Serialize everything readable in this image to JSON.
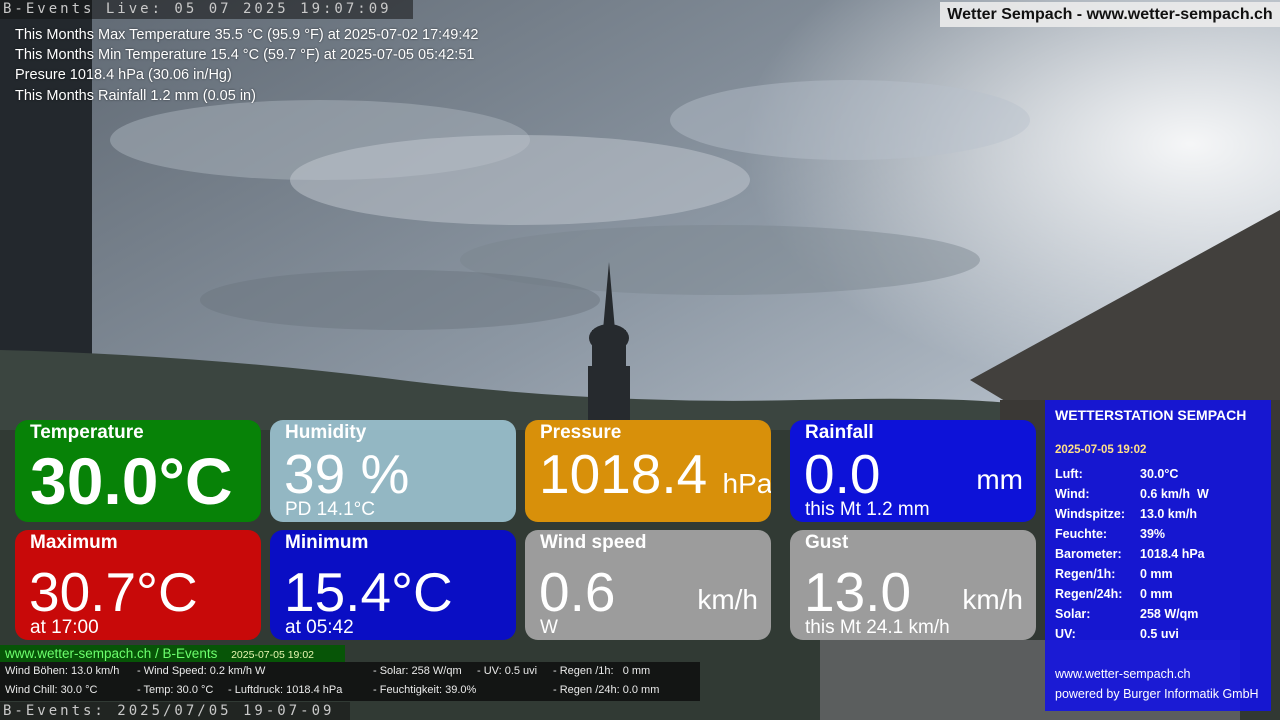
{
  "header": {
    "live_stamp": "B-Events Live: 05 07 2025 19:07:09",
    "site_title": "Wetter Sempach - www.wetter-sempach.ch"
  },
  "stats": [
    "This Months Max Temperature 35.5 °C (95.9 °F) at 2025-07-02 17:49:42",
    "This Months Min Temperature 15.4 °C (59.7 °F) at 2025-07-05 05:42:51",
    "Presure 1018.4 hPa (30.06 in/Hg)",
    "This Months Rainfall 1.2 mm (0.05 in)"
  ],
  "tiles": {
    "temperature": {
      "label": "Temperature",
      "value": "30.0°C",
      "color": "#078207"
    },
    "humidity": {
      "label": "Humidity",
      "value": "39 %",
      "sub": "PD 14.1°C"
    },
    "pressure": {
      "label": "Pressure",
      "value": "1018.4",
      "unit": "hPa",
      "color": "#d8900a"
    },
    "rainfall": {
      "label": "Rainfall",
      "value": "0.0",
      "unit": "mm",
      "sub": "this Mt 1.2 mm"
    },
    "maximum": {
      "label": "Maximum",
      "value": "30.7°C",
      "sub": "at 17:00",
      "color": "#c80909"
    },
    "minimum": {
      "label": "Minimum",
      "value": "15.4°C",
      "sub": "at 05:42"
    },
    "wind_speed": {
      "label": "Wind speed",
      "value": "0.6",
      "unit": "km/h",
      "sub": "W"
    },
    "gust": {
      "label": "Gust",
      "value": "13.0",
      "unit": "km/h",
      "sub": "this Mt 24.1 km/h"
    }
  },
  "side_panel": {
    "title": "WETTERSTATION SEMPACH",
    "timestamp": "2025-07-05 19:02",
    "rows": [
      {
        "k": "Luft:",
        "v": "30.0°C"
      },
      {
        "k": "Wind:",
        "v": "0.6 km/h  W"
      },
      {
        "k": "Windspitze:",
        "v": "13.0 km/h"
      },
      {
        "k": "Feuchte:",
        "v": "39%"
      },
      {
        "k": "Barometer:",
        "v": "1018.4 hPa"
      },
      {
        "k": "Regen/1h:",
        "v": "0 mm"
      },
      {
        "k": "Regen/24h:",
        "v": "0 mm"
      },
      {
        "k": "Solar:",
        "v": "258 W/qm"
      },
      {
        "k": "UV:",
        "v": "0.5 uvi"
      }
    ],
    "website": "www.wetter-sempach.ch",
    "powered": "powered by Burger Informatik GmbH"
  },
  "bottom": {
    "link": "www.wetter-sempach.ch / B-Events",
    "link_date": "2025-07-05 19:02",
    "ticker": {
      "wind_boehen": "Wind Böhen: 13.0 km/h",
      "wind_speed": "- Wind Speed: 0.2 km/h W",
      "solar": "- Solar: 258 W/qm",
      "uv": "- UV: 0.5 uvi",
      "regen_1h": "- Regen /1h:   0 mm",
      "wind_chill": "Wind Chill: 30.0 °C",
      "temp": "- Temp: 30.0 °C",
      "luftdruck": "- Luftdruck: 1018.4 hPa",
      "feuchtigkeit": "- Feuchtigkeit: 39.0%",
      "regen_24h": "- Regen /24h: 0.0 mm"
    },
    "live_stamp": "B-Events: 2025/07/05 19-07-09"
  }
}
